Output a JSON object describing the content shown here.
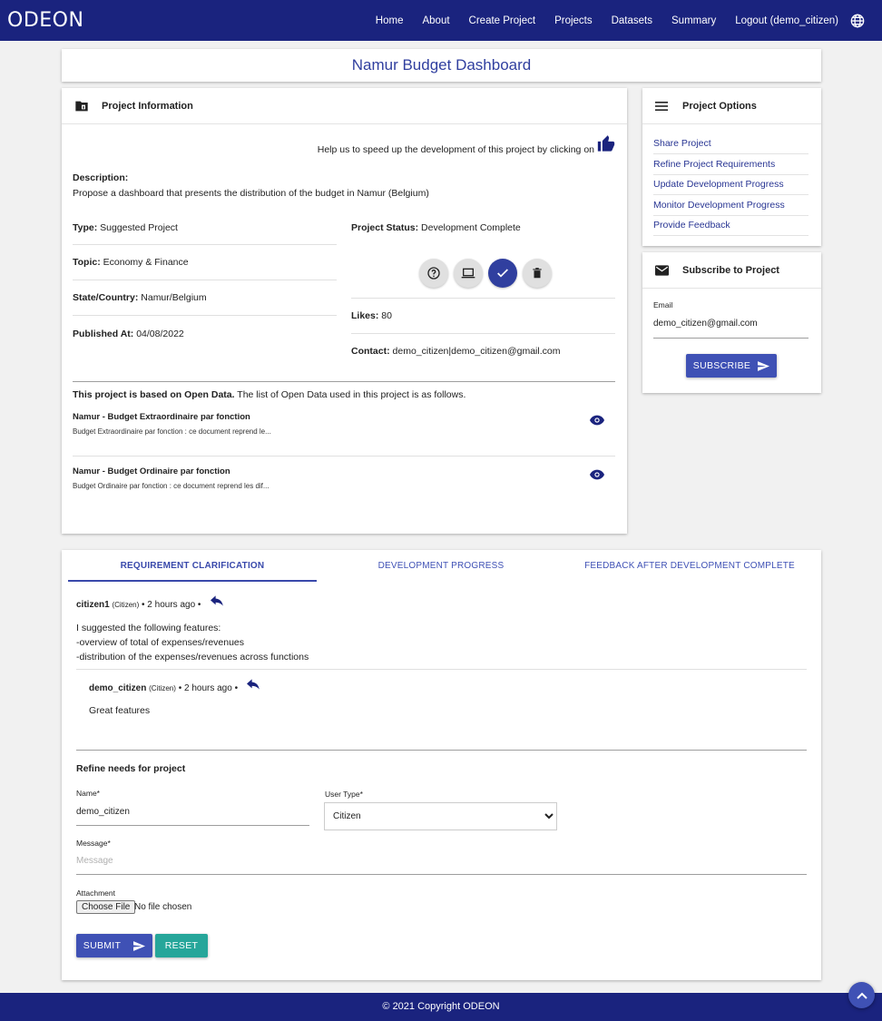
{
  "navbar": {
    "brand": "ODEON",
    "items": [
      "Home",
      "About",
      "Create Project",
      "Projects",
      "Datasets",
      "Summary",
      "Logout (demo_citizen)"
    ]
  },
  "page": {
    "title": "Namur Budget Dashboard"
  },
  "project_info": {
    "header": "Project Information",
    "help_text": "Help us to speed up the development of this project by clicking on",
    "description_label": "Description:",
    "description": "Propose a dashboard that presents the distribution of the budget in Namur (Belgium)",
    "type_label": "Type:",
    "type": "Suggested Project",
    "topic_label": "Topic:",
    "topic": "Economy & Finance",
    "state_label": "State/Country:",
    "state": "Namur/Belgium",
    "published_label": "Published At:",
    "published": "04/08/2022",
    "status_label": "Project Status:",
    "status": "Development Complete",
    "likes_label": "Likes:",
    "likes": "80",
    "contact_label": "Contact:",
    "contact": "demo_citizen|demo_citizen@gmail.com",
    "open_data_bold": "This project is based on Open Data.",
    "open_data_rest": "The list of Open Data used in this project is as follows.",
    "datasets": [
      {
        "title": "Namur - Budget Extraordinaire par fonction",
        "desc": "Budget Extraordinaire par fonction : ce document reprend le..."
      },
      {
        "title": "Namur - Budget Ordinaire par fonction",
        "desc": "Budget Ordinaire par fonction : ce document reprend les dif..."
      }
    ]
  },
  "options": {
    "header": "Project Options",
    "items": [
      "Share Project",
      "Refine Project Requirements",
      "Update Development Progress",
      "Monitor Development Progress",
      "Provide Feedback"
    ]
  },
  "subscribe": {
    "header": "Subscribe to Project",
    "email_label": "Email",
    "email_value": "demo_citizen@gmail.com",
    "button": "SUBSCRIBE"
  },
  "tabs": [
    "REQUIREMENT CLARIFICATION",
    "DEVELOPMENT PROGRESS",
    "FEEDBACK AFTER DEVELOPMENT COMPLETE"
  ],
  "comments": [
    {
      "user": "citizen1",
      "role": "(Citizen)",
      "time": "• 2 hours ago •",
      "lines": [
        "I suggested the following features:",
        "-overview of total of expenses/revenues",
        "-distribution of the expenses/revenues across functions"
      ]
    },
    {
      "user": "demo_citizen",
      "role": "(Citizen)",
      "time": "• 2 hours ago •",
      "lines": [
        "Great features"
      ]
    }
  ],
  "refine_form": {
    "title": "Refine needs for project",
    "name_label": "Name*",
    "name_value": "demo_citizen",
    "usertype_label": "User Type*",
    "usertype_value": "Citizen",
    "message_label": "Message*",
    "message_placeholder": "Message",
    "attachment_label": "Attachment",
    "choose_file": "Choose File",
    "no_file": "No file chosen",
    "submit": "SUBMIT",
    "reset": "RESET"
  },
  "footer": {
    "text": "© 2021 Copyright ODEON"
  },
  "colors": {
    "navbar": "#1a237e",
    "primary": "#3f51b5",
    "accent_teal": "#26a69a"
  }
}
